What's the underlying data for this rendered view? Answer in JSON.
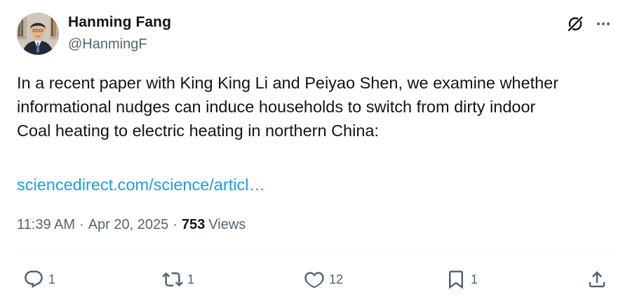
{
  "author": {
    "name": "Hanming Fang",
    "handle": "@HanmingF"
  },
  "header": {
    "grok_icon": "grok-icon",
    "more_icon": "more-horizontal-icon"
  },
  "tweet": {
    "lines": [
      "In a recent paper with King King Li and Peiyao Shen, we examine whether",
      "informational nudges can induce households to switch from dirty indoor",
      "Coal heating to electric heating in northern China:"
    ],
    "link": "sciencedirect.com/science/articl…"
  },
  "meta": {
    "time": "11:39 AM",
    "separator1": "·",
    "date": "Apr 20, 2025",
    "separator2": "·",
    "views_count": "753",
    "views_label": "Views"
  },
  "actions": {
    "replies": "1",
    "reposts": "1",
    "likes": "12",
    "bookmarks": "1"
  },
  "colors": {
    "text": "#0f1419",
    "secondary": "#536471",
    "link": "#1d9bf0",
    "divider": "#eff3f4"
  }
}
